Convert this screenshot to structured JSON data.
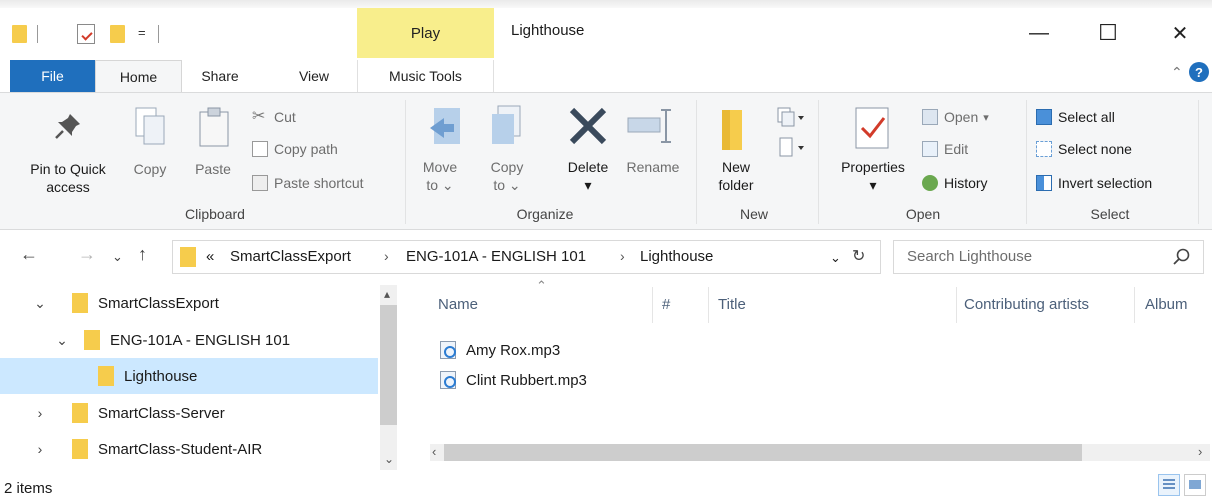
{
  "window": {
    "title": "Lighthouse",
    "context_tab": "Play",
    "controls": {
      "minimize": "—",
      "maximize": "☐",
      "close": "✕"
    }
  },
  "quick_access": {
    "dropdown": "="
  },
  "tabs": [
    {
      "label": "File"
    },
    {
      "label": "Home"
    },
    {
      "label": "Share"
    },
    {
      "label": "View"
    },
    {
      "label": "Music Tools"
    }
  ],
  "ribbon": {
    "clipboard": {
      "label": "Clipboard",
      "pin": "Pin to Quick access",
      "pin_line1": "Pin to Quick",
      "pin_line2": "access",
      "copy": "Copy",
      "paste": "Paste",
      "cut": "Cut",
      "copy_path": "Copy path",
      "paste_shortcut": "Paste shortcut"
    },
    "organize": {
      "label": "Organize",
      "move_to_1": "Move",
      "move_to_2": "to",
      "copy_to_1": "Copy",
      "copy_to_2": "to",
      "delete": "Delete",
      "rename": "Rename"
    },
    "new": {
      "label": "New",
      "new_folder_1": "New",
      "new_folder_2": "folder"
    },
    "open": {
      "label": "Open",
      "properties": "Properties",
      "open": "Open",
      "edit": "Edit",
      "history": "History"
    },
    "select": {
      "label": "Select",
      "select_all": "Select all",
      "select_none": "Select none",
      "invert": "Invert selection"
    }
  },
  "address": {
    "overflow": "«",
    "crumbs": [
      "SmartClassExport",
      "ENG-101A - ENGLISH 101",
      "Lighthouse"
    ],
    "separator": "›"
  },
  "search": {
    "placeholder": "Search Lighthouse"
  },
  "nav_tree": [
    {
      "label": "SmartClassExport",
      "chevron": "⌄"
    },
    {
      "label": "ENG-101A - ENGLISH 101",
      "chevron": "⌄"
    },
    {
      "label": "Lighthouse",
      "chevron": ""
    },
    {
      "label": "SmartClass-Server",
      "chevron": "›"
    },
    {
      "label": "SmartClass-Student-AIR",
      "chevron": "›"
    }
  ],
  "columns": [
    "Name",
    "#",
    "Title",
    "Contributing artists",
    "Album"
  ],
  "files": [
    {
      "name": "Amy Rox.mp3"
    },
    {
      "name": "Clint Rubbert.mp3"
    }
  ],
  "status": {
    "items": "2 items"
  }
}
